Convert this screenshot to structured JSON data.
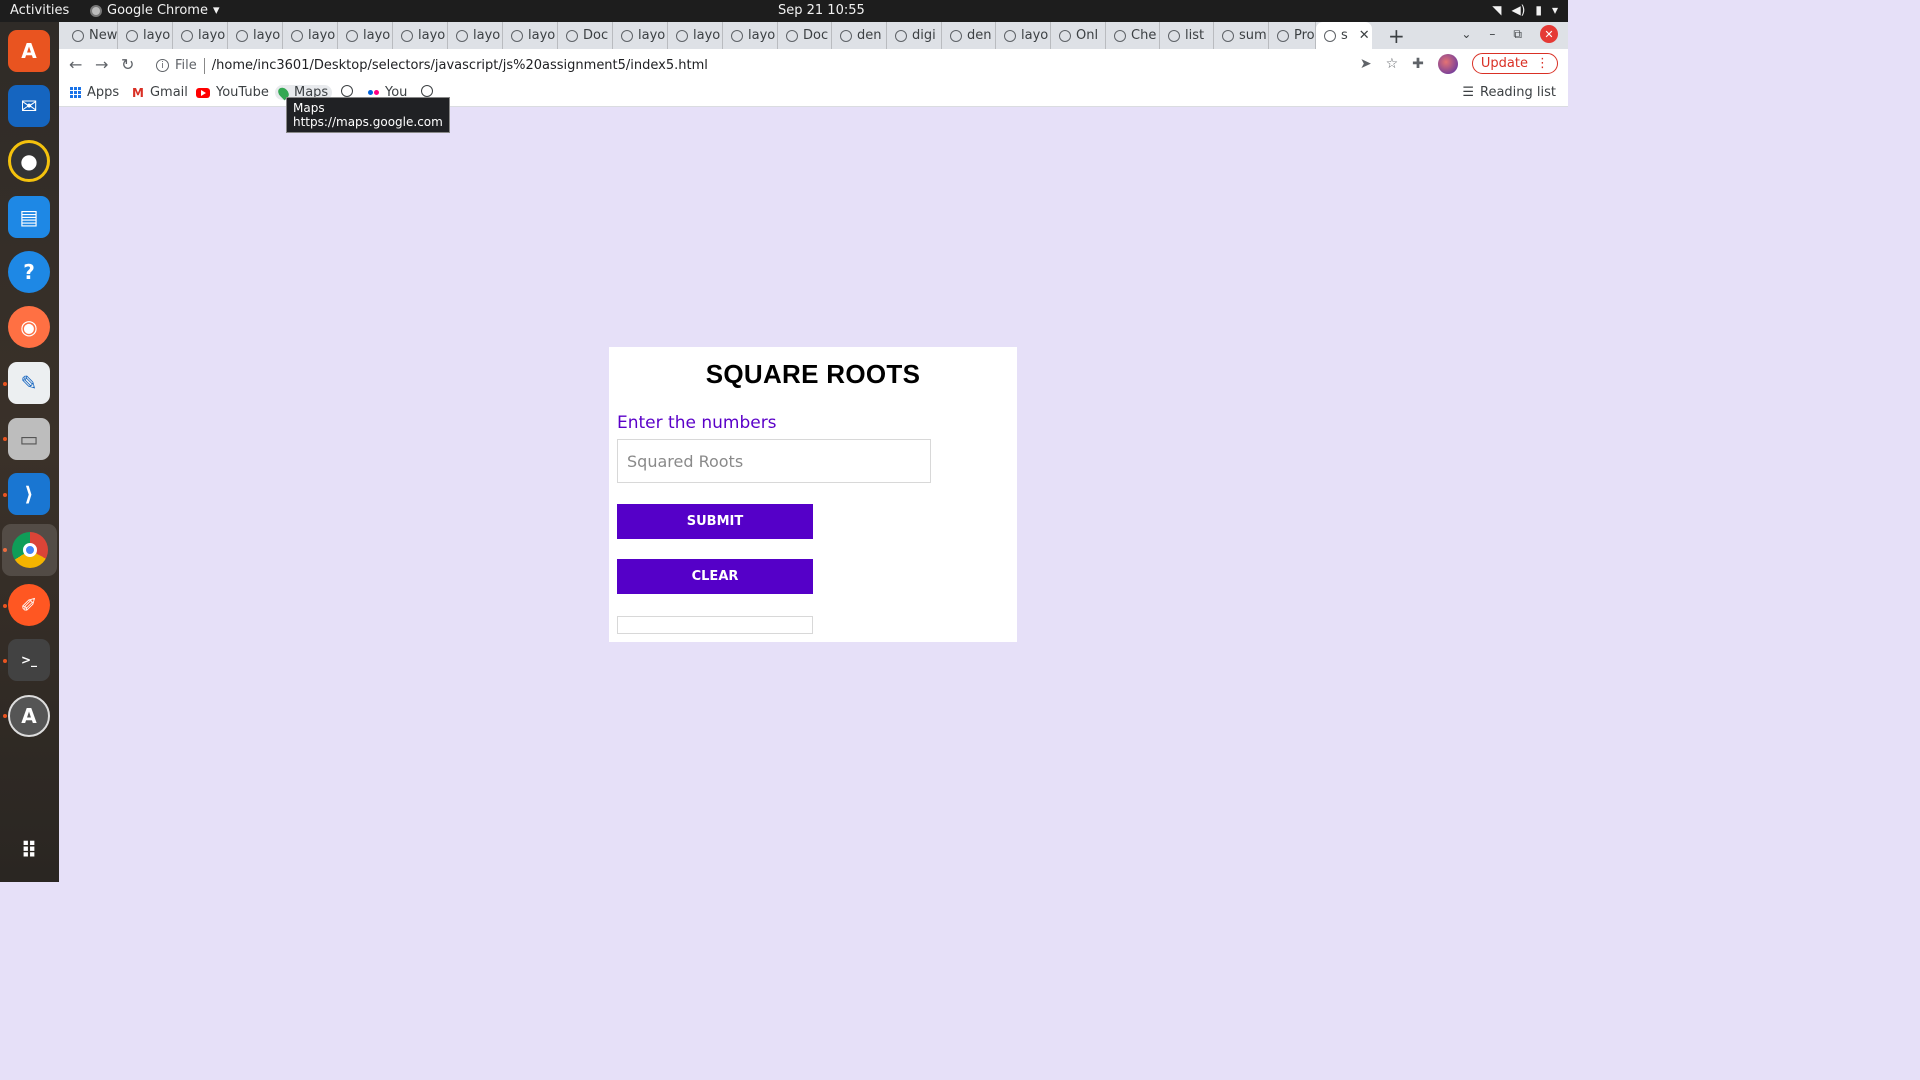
{
  "system": {
    "activities": "Activities",
    "app_name": "Google Chrome",
    "clock": "Sep 21  10:55"
  },
  "tabs": [
    {
      "label": "New"
    },
    {
      "label": "layo"
    },
    {
      "label": "layo"
    },
    {
      "label": "layo"
    },
    {
      "label": "layo"
    },
    {
      "label": "layo"
    },
    {
      "label": "layo"
    },
    {
      "label": "layo"
    },
    {
      "label": "layo"
    },
    {
      "label": "Doc"
    },
    {
      "label": "layo"
    },
    {
      "label": "layo"
    },
    {
      "label": "layo"
    },
    {
      "label": "Doc"
    },
    {
      "label": "den"
    },
    {
      "label": "digi"
    },
    {
      "label": "den"
    },
    {
      "label": "layo"
    },
    {
      "label": "Onl"
    },
    {
      "label": "Che"
    },
    {
      "label": "list"
    },
    {
      "label": "sum"
    },
    {
      "label": "Pro"
    },
    {
      "label": "s"
    }
  ],
  "address_bar": {
    "scheme": "File",
    "url": "/home/inc3601/Desktop/selectors/javascript/js%20assignment5/index5.html"
  },
  "toolbar": {
    "update_label": "Update"
  },
  "bookmarks": {
    "apps": "Apps",
    "gmail": "Gmail",
    "youtube": "YouTube",
    "maps": "Maps",
    "you": "You",
    "reading_list": "Reading list"
  },
  "tooltip": {
    "title": "Maps",
    "url": "https://maps.google.com"
  },
  "page": {
    "title": "SQUARE ROOTS",
    "label": "Enter the numbers",
    "input_placeholder": "Squared Roots",
    "input_value": "",
    "submit_label": "SUBMIT",
    "clear_label": "CLEAR",
    "result": ""
  },
  "colors": {
    "page_background": "#e6e0f8",
    "accent": "#5500c8",
    "label_color": "#5a00c8"
  }
}
